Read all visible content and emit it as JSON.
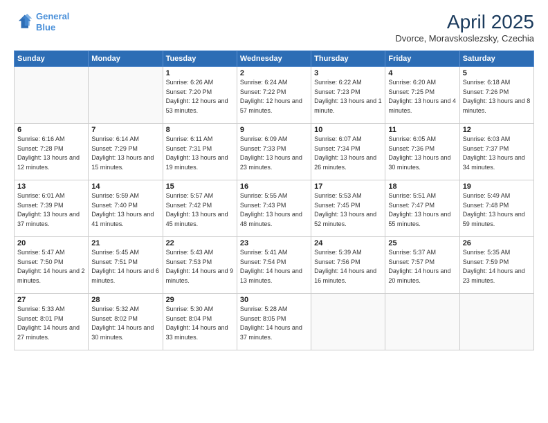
{
  "header": {
    "logo_line1": "General",
    "logo_line2": "Blue",
    "title": "April 2025",
    "location": "Dvorce, Moravskoslezsky, Czechia"
  },
  "days_of_week": [
    "Sunday",
    "Monday",
    "Tuesday",
    "Wednesday",
    "Thursday",
    "Friday",
    "Saturday"
  ],
  "weeks": [
    [
      {
        "day": "",
        "info": ""
      },
      {
        "day": "",
        "info": ""
      },
      {
        "day": "1",
        "info": "Sunrise: 6:26 AM\nSunset: 7:20 PM\nDaylight: 12 hours and 53 minutes."
      },
      {
        "day": "2",
        "info": "Sunrise: 6:24 AM\nSunset: 7:22 PM\nDaylight: 12 hours and 57 minutes."
      },
      {
        "day": "3",
        "info": "Sunrise: 6:22 AM\nSunset: 7:23 PM\nDaylight: 13 hours and 1 minute."
      },
      {
        "day": "4",
        "info": "Sunrise: 6:20 AM\nSunset: 7:25 PM\nDaylight: 13 hours and 4 minutes."
      },
      {
        "day": "5",
        "info": "Sunrise: 6:18 AM\nSunset: 7:26 PM\nDaylight: 13 hours and 8 minutes."
      }
    ],
    [
      {
        "day": "6",
        "info": "Sunrise: 6:16 AM\nSunset: 7:28 PM\nDaylight: 13 hours and 12 minutes."
      },
      {
        "day": "7",
        "info": "Sunrise: 6:14 AM\nSunset: 7:29 PM\nDaylight: 13 hours and 15 minutes."
      },
      {
        "day": "8",
        "info": "Sunrise: 6:11 AM\nSunset: 7:31 PM\nDaylight: 13 hours and 19 minutes."
      },
      {
        "day": "9",
        "info": "Sunrise: 6:09 AM\nSunset: 7:33 PM\nDaylight: 13 hours and 23 minutes."
      },
      {
        "day": "10",
        "info": "Sunrise: 6:07 AM\nSunset: 7:34 PM\nDaylight: 13 hours and 26 minutes."
      },
      {
        "day": "11",
        "info": "Sunrise: 6:05 AM\nSunset: 7:36 PM\nDaylight: 13 hours and 30 minutes."
      },
      {
        "day": "12",
        "info": "Sunrise: 6:03 AM\nSunset: 7:37 PM\nDaylight: 13 hours and 34 minutes."
      }
    ],
    [
      {
        "day": "13",
        "info": "Sunrise: 6:01 AM\nSunset: 7:39 PM\nDaylight: 13 hours and 37 minutes."
      },
      {
        "day": "14",
        "info": "Sunrise: 5:59 AM\nSunset: 7:40 PM\nDaylight: 13 hours and 41 minutes."
      },
      {
        "day": "15",
        "info": "Sunrise: 5:57 AM\nSunset: 7:42 PM\nDaylight: 13 hours and 45 minutes."
      },
      {
        "day": "16",
        "info": "Sunrise: 5:55 AM\nSunset: 7:43 PM\nDaylight: 13 hours and 48 minutes."
      },
      {
        "day": "17",
        "info": "Sunrise: 5:53 AM\nSunset: 7:45 PM\nDaylight: 13 hours and 52 minutes."
      },
      {
        "day": "18",
        "info": "Sunrise: 5:51 AM\nSunset: 7:47 PM\nDaylight: 13 hours and 55 minutes."
      },
      {
        "day": "19",
        "info": "Sunrise: 5:49 AM\nSunset: 7:48 PM\nDaylight: 13 hours and 59 minutes."
      }
    ],
    [
      {
        "day": "20",
        "info": "Sunrise: 5:47 AM\nSunset: 7:50 PM\nDaylight: 14 hours and 2 minutes."
      },
      {
        "day": "21",
        "info": "Sunrise: 5:45 AM\nSunset: 7:51 PM\nDaylight: 14 hours and 6 minutes."
      },
      {
        "day": "22",
        "info": "Sunrise: 5:43 AM\nSunset: 7:53 PM\nDaylight: 14 hours and 9 minutes."
      },
      {
        "day": "23",
        "info": "Sunrise: 5:41 AM\nSunset: 7:54 PM\nDaylight: 14 hours and 13 minutes."
      },
      {
        "day": "24",
        "info": "Sunrise: 5:39 AM\nSunset: 7:56 PM\nDaylight: 14 hours and 16 minutes."
      },
      {
        "day": "25",
        "info": "Sunrise: 5:37 AM\nSunset: 7:57 PM\nDaylight: 14 hours and 20 minutes."
      },
      {
        "day": "26",
        "info": "Sunrise: 5:35 AM\nSunset: 7:59 PM\nDaylight: 14 hours and 23 minutes."
      }
    ],
    [
      {
        "day": "27",
        "info": "Sunrise: 5:33 AM\nSunset: 8:01 PM\nDaylight: 14 hours and 27 minutes."
      },
      {
        "day": "28",
        "info": "Sunrise: 5:32 AM\nSunset: 8:02 PM\nDaylight: 14 hours and 30 minutes."
      },
      {
        "day": "29",
        "info": "Sunrise: 5:30 AM\nSunset: 8:04 PM\nDaylight: 14 hours and 33 minutes."
      },
      {
        "day": "30",
        "info": "Sunrise: 5:28 AM\nSunset: 8:05 PM\nDaylight: 14 hours and 37 minutes."
      },
      {
        "day": "",
        "info": ""
      },
      {
        "day": "",
        "info": ""
      },
      {
        "day": "",
        "info": ""
      }
    ]
  ]
}
